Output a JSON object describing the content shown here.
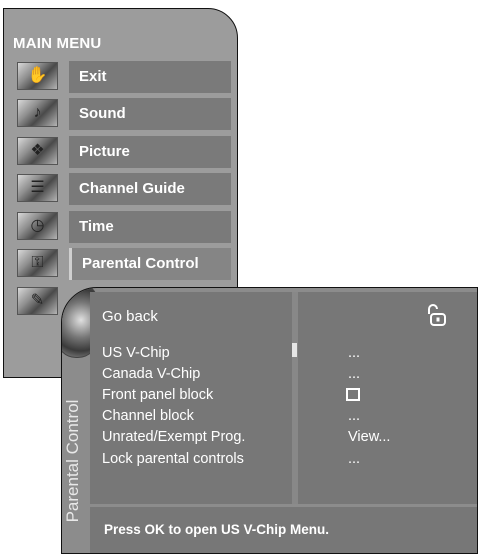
{
  "main_menu": {
    "title": "MAIN MENU",
    "items": [
      {
        "label": "Exit",
        "icon": "exit-icon",
        "selected": false
      },
      {
        "label": "Sound",
        "icon": "sound-icon",
        "selected": false
      },
      {
        "label": "Picture",
        "icon": "picture-icon",
        "selected": false
      },
      {
        "label": "Channel Guide",
        "icon": "channel-guide-icon",
        "selected": false
      },
      {
        "label": "Time",
        "icon": "time-icon",
        "selected": false
      },
      {
        "label": "Parental Control",
        "icon": "parental-control-icon",
        "selected": true
      },
      {
        "label": "",
        "icon": "setup-icon",
        "selected": false
      }
    ]
  },
  "parental_control": {
    "side_title": "Parental Control",
    "go_back": "Go back",
    "items": [
      {
        "label": "US V-Chip",
        "value": "..."
      },
      {
        "label": "Canada V-Chip",
        "value": "..."
      },
      {
        "label": "Front panel block",
        "value": "",
        "control": "checkbox",
        "checked": false
      },
      {
        "label": "Channel block",
        "value": "..."
      },
      {
        "label": "Unrated/Exempt Prog.",
        "value": "View..."
      },
      {
        "label": "Lock parental controls",
        "value": "..."
      }
    ],
    "status_text": "Press OK to open US V-Chip Menu.",
    "lock_icon": "unlocked-padlock-icon"
  },
  "colors": {
    "panel": "#9c9c9c",
    "bar": "#7a7a7a",
    "text": "#ffffff"
  }
}
